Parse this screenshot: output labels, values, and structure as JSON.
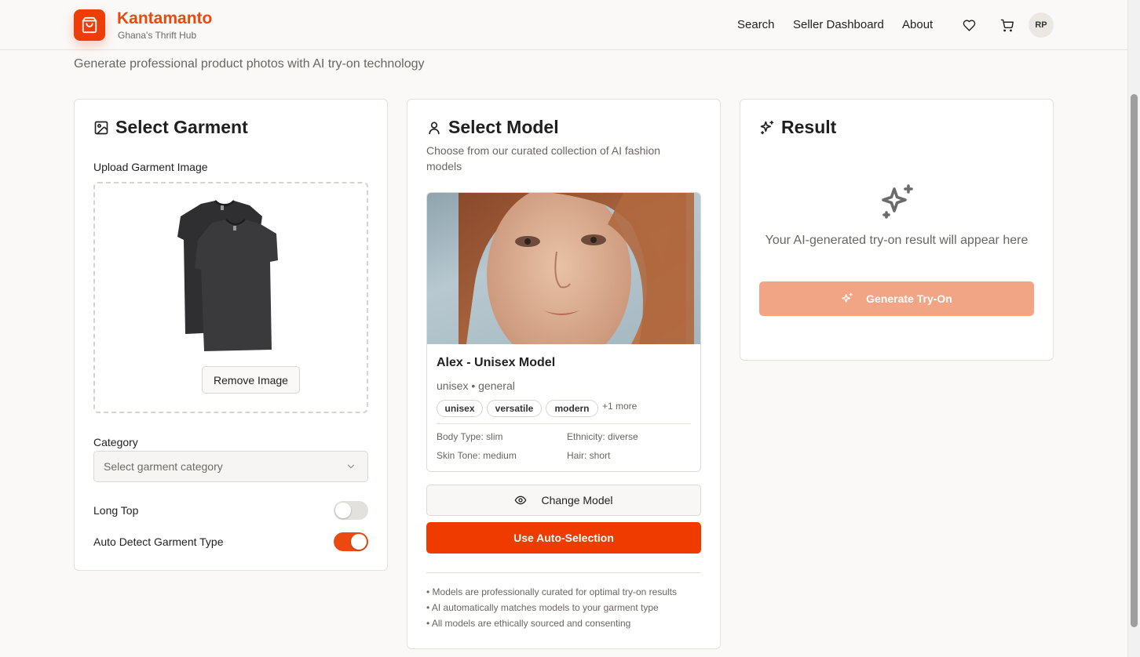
{
  "header": {
    "brand_name": "Kantamanto",
    "brand_tagline": "Ghana's Thrift Hub",
    "nav": [
      "Search",
      "Seller Dashboard",
      "About"
    ],
    "avatar_initials": "RP"
  },
  "page_subtitle": "Generate professional product photos with AI try-on technology",
  "garment": {
    "title": "Select Garment",
    "upload_label": "Upload Garment Image",
    "remove_button": "Remove Image",
    "category_label": "Category",
    "category_placeholder": "Select garment category",
    "long_top_label": "Long Top",
    "long_top_on": false,
    "auto_detect_label": "Auto Detect Garment Type",
    "auto_detect_on": true
  },
  "model": {
    "title": "Select Model",
    "description": "Choose from our curated collection of AI fashion models",
    "name": "Alex - Unisex Model",
    "meta": "unisex • general",
    "tags": [
      "unisex",
      "versatile",
      "modern"
    ],
    "more_tags": "+1 more",
    "body_type": "Body Type: slim",
    "ethnicity": "Ethnicity: diverse",
    "skin_tone": "Skin Tone: medium",
    "hair": "Hair: short",
    "change_button": "Change Model",
    "auto_button": "Use Auto-Selection",
    "notes": [
      "• Models are professionally curated for optimal try-on results",
      "• AI automatically matches models to your garment type",
      "• All models are ethically sourced and consenting"
    ]
  },
  "result": {
    "title": "Result",
    "placeholder": "Your AI-generated try-on result will appear here",
    "generate_button": "Generate Try-On"
  },
  "colors": {
    "brand": "#ef3d0a",
    "primary_button": "#ef3a00",
    "disabled_button": "#f2a585"
  }
}
